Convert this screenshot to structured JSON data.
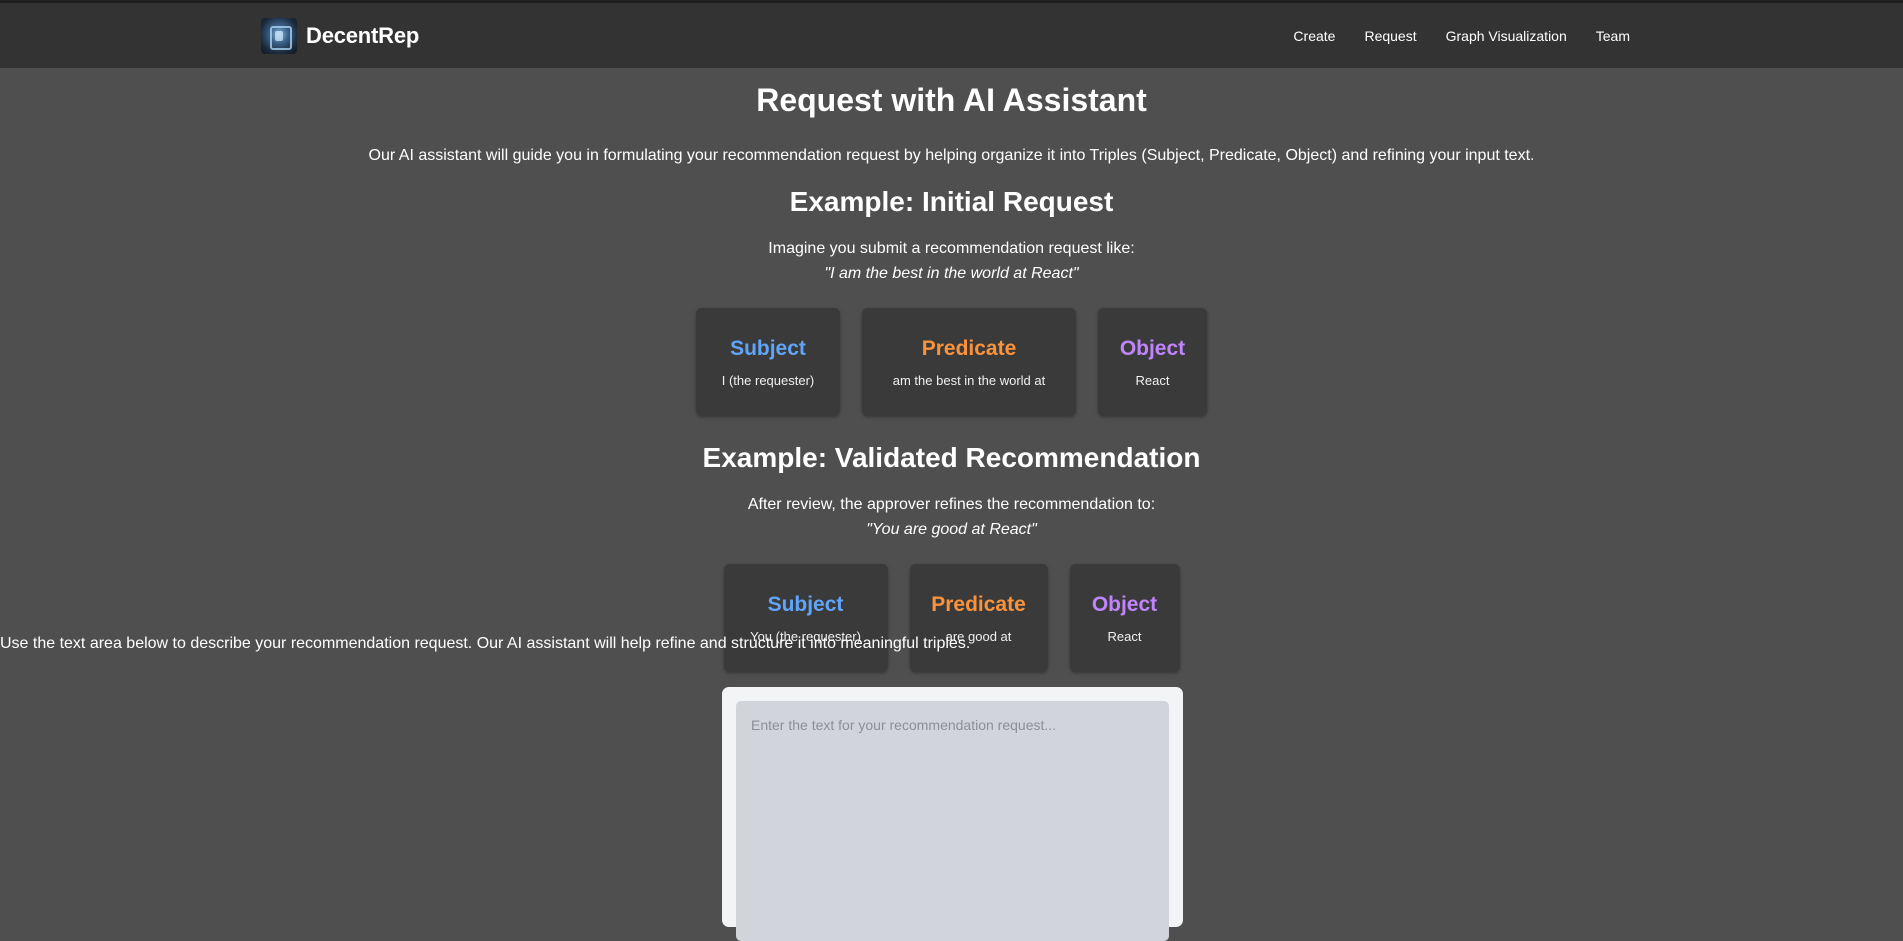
{
  "app": {
    "brand": "DecentRep",
    "logo_icon": "network-logo-icon"
  },
  "nav": {
    "items": [
      {
        "label": "Create"
      },
      {
        "label": "Request"
      },
      {
        "label": "Graph Visualization"
      },
      {
        "label": "Team"
      }
    ]
  },
  "page": {
    "title": "Request with AI Assistant",
    "intro": "Our AI assistant will guide you in formulating your recommendation request by helping organize it into Triples (Subject, Predicate, Object) and refining your input text."
  },
  "initial_example": {
    "heading": "Example: Initial Request",
    "lead": "Imagine you submit a recommendation request like:",
    "quote": "\"I am the best in the world at React\"",
    "cards": [
      {
        "title": "Subject",
        "value": "I (the requester)"
      },
      {
        "title": "Predicate",
        "value": "am the best in the world at"
      },
      {
        "title": "Object",
        "value": "React"
      }
    ]
  },
  "validated_example": {
    "heading": "Example: Validated Recommendation",
    "lead": "After review, the approver refines the recommendation to:",
    "quote": "\"You are good at React\"",
    "cards": [
      {
        "title": "Subject",
        "value": "You (the requester)"
      },
      {
        "title": "Predicate",
        "value": "are good at"
      },
      {
        "title": "Object",
        "value": "React"
      }
    ]
  },
  "request_form": {
    "hint": "Use the text area below to describe your recommendation request. Our AI assistant will help refine and structure it into meaningful triples.",
    "placeholder": "Enter the text for your recommendation request...",
    "value": ""
  },
  "colors": {
    "background": "#4f4f4f",
    "header": "#333333",
    "card": "#3a3a3a",
    "subject": "#60a5fa",
    "predicate": "#fb923c",
    "object": "#c084fc"
  }
}
